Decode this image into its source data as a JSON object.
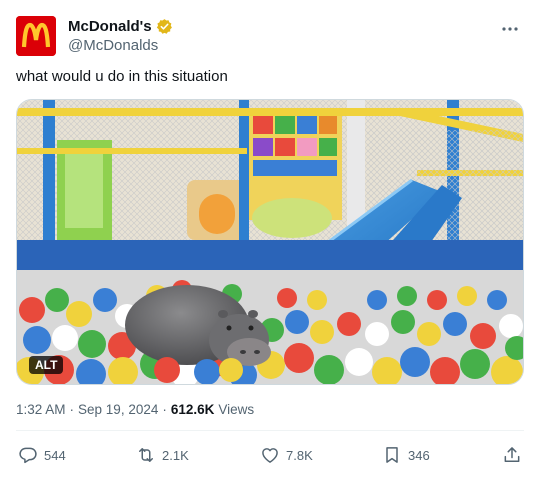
{
  "author": {
    "display_name": "McDonald's",
    "handle": "@McDonalds",
    "avatar_icon": "mcdonalds-logo",
    "verified_icon": "gold-verified-badge",
    "brand_color": "#db0007",
    "logo_color": "#ffc72c"
  },
  "tweet": {
    "text": "what would u do in this situation",
    "media_alt_badge": "ALT"
  },
  "meta": {
    "time": "1:32 AM",
    "separator": "·",
    "date": "Sep 19, 2024",
    "views_count": "612.6K",
    "views_label": "Views"
  },
  "actions": {
    "replies": "544",
    "reposts": "2.1K",
    "likes": "7.8K",
    "bookmarks": "346"
  },
  "icons": {
    "reply": "reply-icon",
    "repost": "repost-icon",
    "like": "heart-icon",
    "bookmark": "bookmark-icon",
    "share": "share-icon",
    "more": "more-icon"
  }
}
